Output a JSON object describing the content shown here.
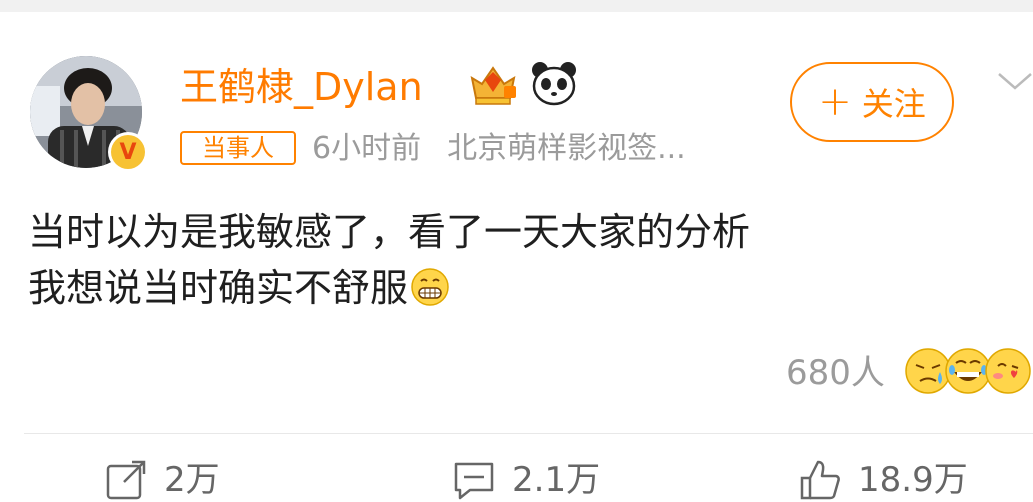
{
  "post": {
    "author": {
      "name": "王鹤棣_Dylan",
      "verified_badge": "V",
      "badge_icons": [
        "crown-diamond-icon",
        "panda-icon"
      ]
    },
    "follow_button": {
      "label": "关注",
      "plus": "+"
    },
    "tag": "当事人",
    "time": "6小时前",
    "source": "北京萌样影视签...",
    "content": {
      "line1": "当时以为是我敏感了，看了一天大家的分析",
      "line2": "我想说当时确实不舒服"
    },
    "reactions": {
      "count": "680人",
      "icons": [
        "tired-face-icon",
        "laughing-face-icon",
        "kiss-face-icon"
      ]
    },
    "actions": {
      "repost": {
        "count": "2万",
        "icon": "repost-icon"
      },
      "comment": {
        "count": "2.1万",
        "icon": "comment-icon"
      },
      "like": {
        "count": "18.9万",
        "icon": "thumbs-up-icon"
      }
    },
    "colors": {
      "accent": "#ff8200",
      "name": "#ff7b00",
      "meta": "#9b9b9b"
    }
  }
}
